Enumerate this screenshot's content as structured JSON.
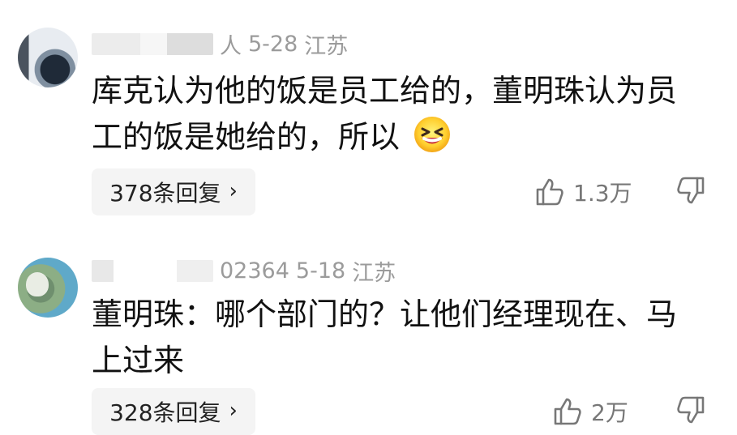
{
  "comments": [
    {
      "username_tail": "人",
      "date": "5-28",
      "location": "江苏",
      "text_line1": "库克认为他的饭是员工给的，董明珠认为员",
      "text_line2": "工的饭是她给的，所以",
      "emoji": "grinning-squinting-face",
      "reply_label": "378条回复",
      "likes": "1.3万"
    },
    {
      "username_tail": "02364",
      "date": "5-18",
      "location": "江苏",
      "text_line1": "董明珠：哪个部门的？让他们经理现在、马",
      "text_line2": "上过来",
      "reply_label": "328条回复",
      "likes": "2万"
    }
  ],
  "icons": {
    "like": "thumbs-up-icon",
    "dislike": "thumbs-down-icon",
    "reply": "chevron-right-icon"
  },
  "colors": {
    "text": "#111111",
    "meta": "#9b9b9b",
    "pill": "#f4f4f4",
    "action": "#777777"
  }
}
